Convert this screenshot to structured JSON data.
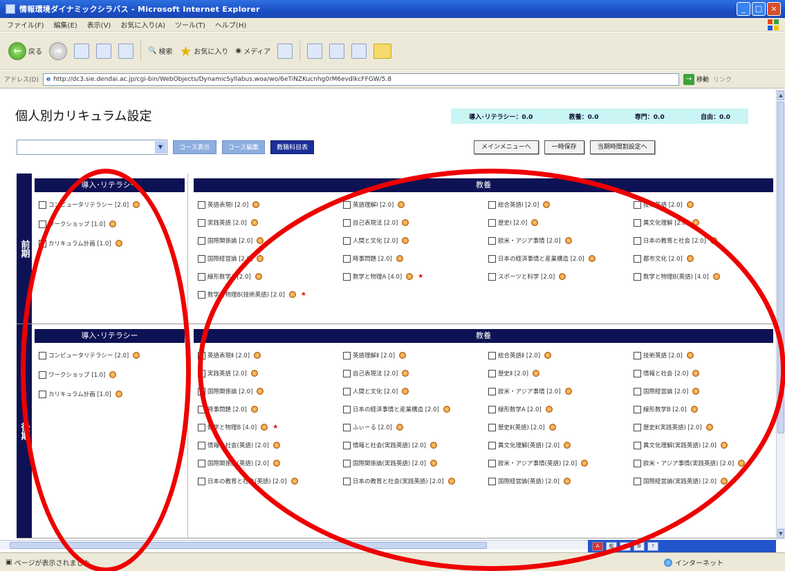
{
  "window": {
    "title": "情報環境ダイナミックシラバス - Microsoft Internet Explorer",
    "minimize": "_",
    "maximize": "□",
    "close": "×"
  },
  "menubar": [
    "ファイル(F)",
    "編集(E)",
    "表示(V)",
    "お気に入り(A)",
    "ツール(T)",
    "ヘルプ(H)"
  ],
  "toolbar": {
    "back_label": "戻る",
    "search_label": "検索",
    "favorites_label": "お気に入り",
    "media_label": "メディア"
  },
  "address": {
    "label": "アドレス(D)",
    "url": "http://dc3.sie.dendai.ac.jp/cgi-bin/WebObjects/DynamicSyllabus.woa/wo/6eTiNZKucnhg0rM6evdlkcFFGW/5.8",
    "go_label": "移動",
    "links_label": "リンク"
  },
  "page": {
    "title": "個人別カリキュラム設定",
    "summary": [
      "導入･リテラシー：0.0",
      "教養：0.0",
      "専門：0.0",
      "自由：0.0"
    ],
    "course_select_value": "",
    "buttons": {
      "course_show": "コース表示",
      "course_edit": "コース編集",
      "teacher": "教職科目表"
    },
    "nav": {
      "main_menu": "メインメニューへ",
      "temp_save": "一時保存",
      "term_setting": "当期時間割設定へ"
    }
  },
  "terms": [
    {
      "label": "前期",
      "intro_header": "導入･リテラシー",
      "intro_courses": [
        {
          "name": "コンピュータリテラシー [2.0]"
        },
        {
          "name": "ワークショップ [1.0]"
        },
        {
          "name": "カリキュラム計画 [1.0]"
        }
      ],
      "kyoyo_header": "教養",
      "kyoyo_courses": [
        {
          "name": "英語表現Ⅰ [2.0]"
        },
        {
          "name": "英語理解Ⅰ [2.0]"
        },
        {
          "name": "総合英語Ⅰ [2.0]"
        },
        {
          "name": "技術英語 [2.0]"
        },
        {
          "name": "実践英語 [2.0]"
        },
        {
          "name": "自己表現法 [2.0]"
        },
        {
          "name": "歴史Ⅰ [2.0]"
        },
        {
          "name": "異文化理解 [2.0]"
        },
        {
          "name": "国際関係論 [2.0]"
        },
        {
          "name": "人間と文化 [2.0]"
        },
        {
          "name": "欧米・アジア事情 [2.0]"
        },
        {
          "name": "日本の教育と社会 [2.0]"
        },
        {
          "name": "国際経営論 [2.0]"
        },
        {
          "name": "時事問題 [2.0]"
        },
        {
          "name": "日本の経済事情と産業構造 [2.0]"
        },
        {
          "name": "都市文化 [2.0]"
        },
        {
          "name": "線形数学A [2.0]"
        },
        {
          "name": "数学と物理A [4.0]",
          "req": "★"
        },
        {
          "name": "スポーツと科学 [2.0]"
        },
        {
          "name": "数学と物理B(英語) [4.0]"
        },
        {
          "name": "数学と物理B(技術英語) [2.0]",
          "req": "★"
        }
      ]
    },
    {
      "label": "後期",
      "intro_header": "導入･リテラシー",
      "intro_courses": [
        {
          "name": "コンピュータリテラシー [2.0]"
        },
        {
          "name": "ワークショップ [1.0]"
        },
        {
          "name": "カリキュラム計画 [1.0]"
        }
      ],
      "kyoyo_header": "教養",
      "kyoyo_courses": [
        {
          "name": "英語表現Ⅱ [2.0]"
        },
        {
          "name": "英語理解Ⅱ [2.0]"
        },
        {
          "name": "総合英語Ⅱ [2.0]"
        },
        {
          "name": "技術英語 [2.0]"
        },
        {
          "name": "実践英語 [2.0]"
        },
        {
          "name": "自己表現法 [2.0]"
        },
        {
          "name": "歴史Ⅱ [2.0]"
        },
        {
          "name": "情報と社会 [2.0]"
        },
        {
          "name": "国際関係論 [2.0]"
        },
        {
          "name": "人間と文化 [2.0]"
        },
        {
          "name": "欧米・アジア事情 [2.0]"
        },
        {
          "name": "国際経営論 [2.0]"
        },
        {
          "name": "時事問題 [2.0]"
        },
        {
          "name": "日本の経済事情と産業構造 [2.0]"
        },
        {
          "name": "線形数学A [2.0]"
        },
        {
          "name": "線形数学B [2.0]"
        },
        {
          "name": "数学と物理B [4.0]",
          "req": "★"
        },
        {
          "name": "ふぃーる [2.0]"
        },
        {
          "name": "歴史Ⅱ(英語) [2.0]"
        },
        {
          "name": "歴史Ⅱ(実践英語) [2.0]"
        },
        {
          "name": "情報と社会(英語) [2.0]"
        },
        {
          "name": "情報と社会(実践英語) [2.0]"
        },
        {
          "name": "異文化理解(英語) [2.0]"
        },
        {
          "name": "異文化理解(実践英語) [2.0]"
        },
        {
          "name": "国際関係論(英語) [2.0]"
        },
        {
          "name": "国際関係論(実践英語) [2.0]"
        },
        {
          "name": "欧米・アジア事情(英語) [2.0]"
        },
        {
          "name": "欧米・アジア事情(実践英語) [2.0]"
        },
        {
          "name": "日本の教育と社会(英語) [2.0]"
        },
        {
          "name": "日本の教育と社会(実践英語) [2.0]"
        },
        {
          "name": "国際経営論(英語) [2.0]"
        },
        {
          "name": "国際経営論(実践英語) [2.0]"
        }
      ]
    }
  ],
  "status": {
    "text": "ページが表示されました",
    "zone": "インターネット"
  },
  "colors": {
    "header_navy": "#0d1254",
    "annotation_red": "#ee0000",
    "summary_bg": "#c9f5f5"
  }
}
